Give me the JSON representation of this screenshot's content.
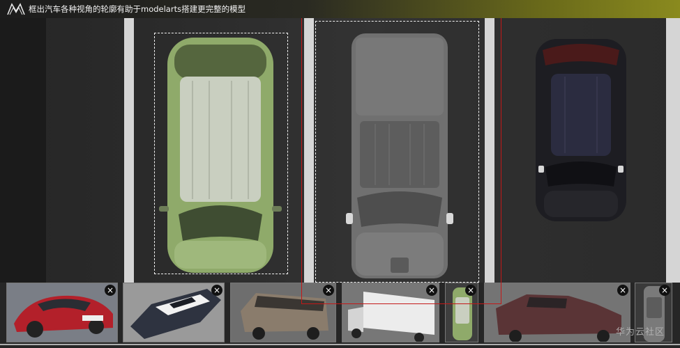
{
  "header": {
    "title": "框出汽车各种视角的轮廓有助于modelarts搭建更完整的模型",
    "logo_icon": "modelarts-logo-icon"
  },
  "scene": {
    "cars": [
      {
        "name": "green-suv",
        "color": "#8faa6a"
      },
      {
        "name": "gray-pickup",
        "color": "#6e6e6e"
      },
      {
        "name": "black-suv",
        "color": "#1d1d22"
      }
    ],
    "selection_color": "#f2f2f2",
    "highlight_color": "#c41818"
  },
  "thumbnails": [
    {
      "name": "red-sports-car",
      "close": "×"
    },
    {
      "name": "police-car",
      "close": "×"
    },
    {
      "name": "van",
      "close": "×"
    },
    {
      "name": "box-truck",
      "close": "×"
    },
    {
      "name": "green-suv-top",
      "close": "×"
    },
    {
      "name": "pickup-truck",
      "close": "×"
    },
    {
      "name": "gray-car-top",
      "close": "×"
    }
  ],
  "watermark": "华为云社区"
}
